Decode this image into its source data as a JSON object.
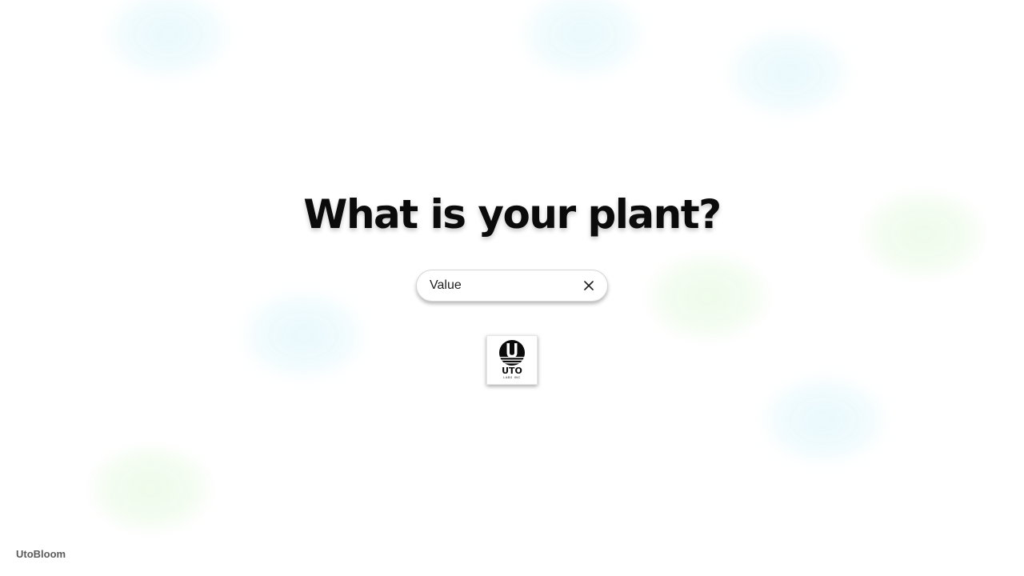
{
  "headline": "What is your plant?",
  "search": {
    "value": "Value",
    "clear_icon": "close-icon"
  },
  "logo": {
    "icon": "uto-labs-logo",
    "wordmark": "UTO",
    "tagline": "LABS INC"
  },
  "footer": {
    "brand": "UtoBloom"
  },
  "colors": {
    "background": "#ffffff",
    "text": "#0b0b0b",
    "footer_text": "#5a5a5a",
    "blob_blue": "#e6f8fc",
    "blob_green": "#ecfae8"
  }
}
